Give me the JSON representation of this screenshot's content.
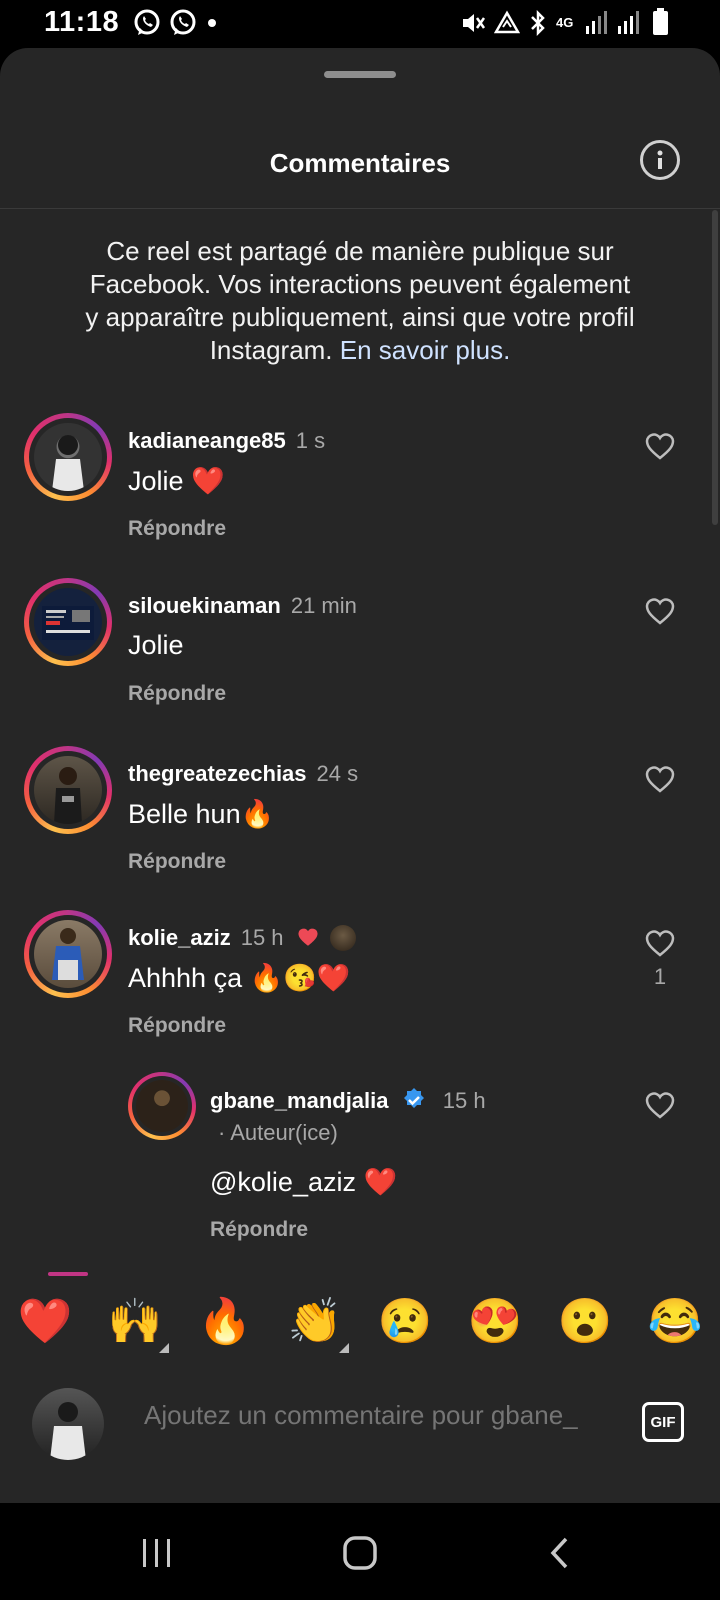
{
  "status_bar": {
    "time": "11:18",
    "network": "4G"
  },
  "sheet": {
    "title": "Commentaires",
    "notice_text": "Ce reel est partagé de manière publique sur Facebook. Vos interactions peuvent également y apparaître publiquement, ainsi que votre profil Instagram.",
    "notice_link": "En savoir plus."
  },
  "comments": [
    {
      "username": "kadianeange85",
      "time": "1 s",
      "text": "Jolie ❤️",
      "reply": "Répondre"
    },
    {
      "username": "silouekinaman",
      "time": "21 min",
      "text": "Jolie",
      "reply": "Répondre"
    },
    {
      "username": "thegreatezechias",
      "time": "24 s",
      "text": "Belle hun🔥",
      "reply": "Répondre"
    },
    {
      "username": "kolie_aziz",
      "time": "15 h",
      "text": "Ahhhh ça 🔥😘❤️",
      "reply": "Répondre",
      "likes": "1"
    },
    {
      "username": "gbane_mandjalia",
      "time": "15 h",
      "author_tag": "· Auteur(ice)",
      "text": "@kolie_aziz ❤️",
      "reply": "Répondre"
    }
  ],
  "reactions": [
    "❤️",
    "🙌",
    "🔥",
    "👏",
    "😢",
    "😍",
    "😮",
    "😂"
  ],
  "input": {
    "placeholder": "Ajoutez un commentaire pour gbane_",
    "gif_label": "GIF"
  },
  "colors": {
    "sheet_bg": "#262626",
    "text_secondary": "#a8a8a8",
    "heart_red": "#ed4956",
    "verified_blue": "#3897f0"
  }
}
